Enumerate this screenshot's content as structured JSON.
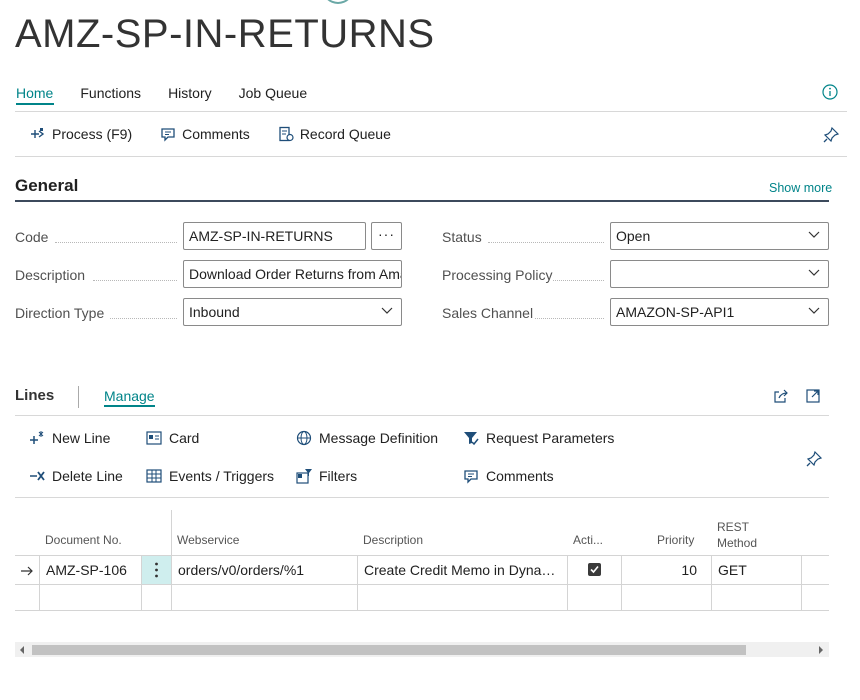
{
  "page": {
    "title": "AMZ-SP-IN-RETURNS"
  },
  "tabs": [
    {
      "label": "Home",
      "active": true
    },
    {
      "label": "Functions"
    },
    {
      "label": "History"
    },
    {
      "label": "Job Queue"
    }
  ],
  "actions": {
    "process": "Process (F9)",
    "comments": "Comments",
    "record_queue": "Record Queue"
  },
  "general": {
    "title": "General",
    "show_more": "Show more",
    "code_label": "Code",
    "code_value": "AMZ-SP-IN-RETURNS",
    "ellipsis": "···",
    "description_label": "Description",
    "description_value": "Download Order Returns from Amazon",
    "direction_label": "Direction Type",
    "direction_value": "Inbound",
    "status_label": "Status",
    "status_value": "Open",
    "policy_label": "Processing Policy",
    "policy_value": "",
    "channel_label": "Sales Channel",
    "channel_value": "AMAZON-SP-API1"
  },
  "lines": {
    "title": "Lines",
    "manage": "Manage",
    "actions": {
      "new_line": "New Line",
      "card": "Card",
      "message_definition": "Message Definition",
      "request_parameters": "Request Parameters",
      "delete_line": "Delete Line",
      "events_triggers": "Events / Triggers",
      "filters": "Filters",
      "comments": "Comments"
    },
    "columns": {
      "doc_no": "Document No.",
      "webservice": "Webservice",
      "description": "Description",
      "active": "Acti...",
      "priority": "Priority",
      "rest_method_1": "REST",
      "rest_method_2": "Method"
    },
    "rows": [
      {
        "doc_no": "AMZ-SP-106",
        "webservice": "orders/v0/orders/%1",
        "description": "Create Credit Memo in Dynamics",
        "active": true,
        "priority": "10",
        "rest_method": "GET"
      }
    ]
  },
  "colors": {
    "accent": "#008489",
    "rule": "#3c4a5c"
  }
}
